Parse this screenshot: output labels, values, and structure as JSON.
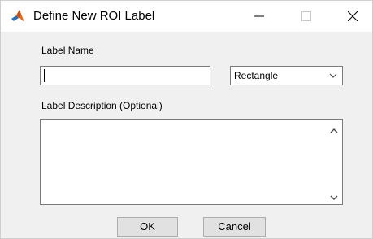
{
  "window": {
    "title": "Define New ROI Label"
  },
  "titlebar": {
    "app_icon": "matlab-logo-icon",
    "minimize_icon": "minimize-icon",
    "maximize_icon": "maximize-icon",
    "close_icon": "close-icon"
  },
  "form": {
    "label_name_text": "Label Name",
    "label_name_value": "",
    "shape_select_value": "Rectangle",
    "label_description_text": "Label Description (Optional)",
    "description_value": ""
  },
  "buttons": {
    "ok_label": "OK",
    "cancel_label": "Cancel"
  },
  "colors": {
    "dialog_background": "#f0f0f0",
    "titlebar_background": "#ffffff",
    "field_border": "#7a7a7a",
    "button_background": "#e1e1e1",
    "matlab_orange": "#e66b1f",
    "matlab_blue": "#2f6fb4"
  }
}
